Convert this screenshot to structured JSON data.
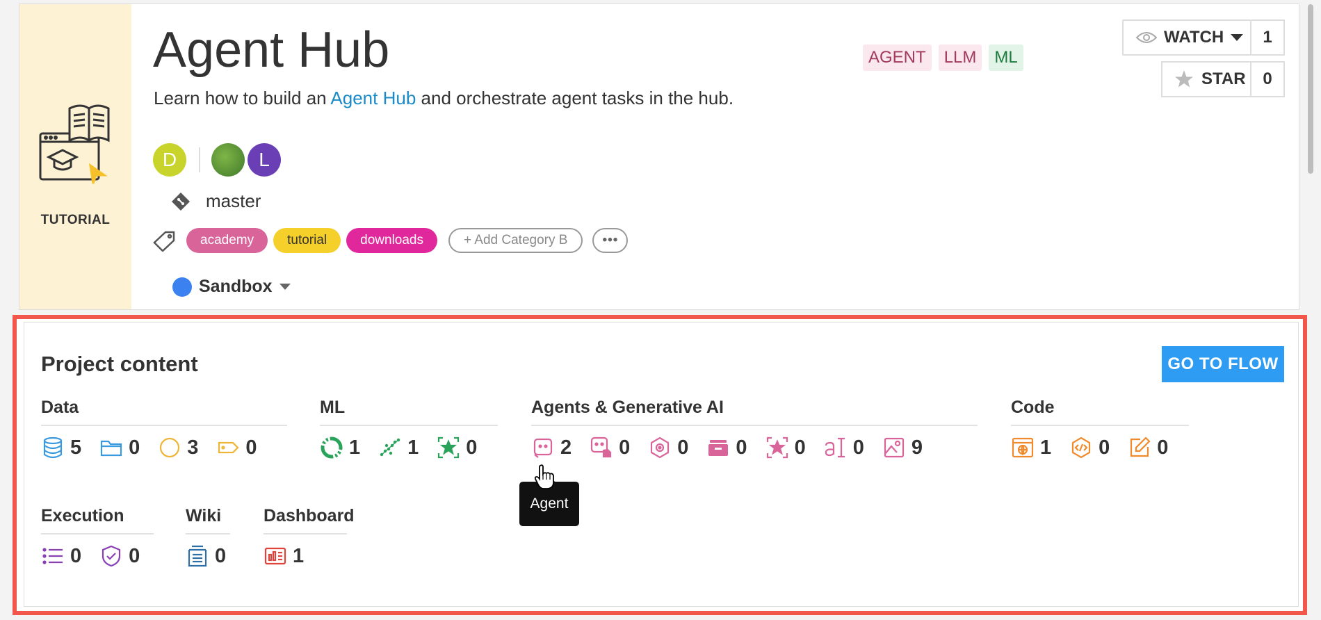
{
  "header": {
    "hero_label": "TUTORIAL",
    "title": "Agent Hub",
    "description_prefix": "Learn how to build an ",
    "description_link": "Agent Hub",
    "description_suffix": " and orchestrate agent tasks in the hub.",
    "type_tags": [
      "AGENT",
      "LLM",
      "ML"
    ],
    "watch_label": "WATCH",
    "watch_count": "1",
    "star_label": "STAR",
    "star_count": "0",
    "avatars": {
      "first": "D",
      "third": "L"
    },
    "branch": "master",
    "categories": [
      "academy",
      "tutorial",
      "downloads"
    ],
    "add_category": "+ Add Category B",
    "more": "•••",
    "workspace": "Sandbox"
  },
  "content": {
    "title": "Project content",
    "go_to_flow": "GO TO FLOW",
    "groups": {
      "data": {
        "title": "Data",
        "counts": [
          "5",
          "0",
          "3",
          "0"
        ]
      },
      "ml": {
        "title": "ML",
        "counts": [
          "1",
          "1",
          "0"
        ]
      },
      "agents": {
        "title": "Agents & Generative AI",
        "counts": [
          "2",
          "0",
          "0",
          "0",
          "0",
          "0",
          "9"
        ]
      },
      "code": {
        "title": "Code",
        "counts": [
          "1",
          "0",
          "0"
        ]
      },
      "execution": {
        "title": "Execution",
        "counts": [
          "0",
          "0"
        ]
      },
      "wiki": {
        "title": "Wiki",
        "counts": [
          "0"
        ]
      },
      "dashboard": {
        "title": "Dashboard",
        "counts": [
          "1"
        ]
      }
    },
    "tooltip": "Agent"
  },
  "colors": {
    "data": "#3a9ae0",
    "data_orange": "#f0b436",
    "ml": "#29a35a",
    "agents": "#d9649a",
    "code": "#f08a2a",
    "execution": "#8a3fb5",
    "wiki": "#2f6fa8",
    "dashboard": "#e0433a",
    "accent": "#2e9cf2",
    "highlight": "#f1574a"
  }
}
